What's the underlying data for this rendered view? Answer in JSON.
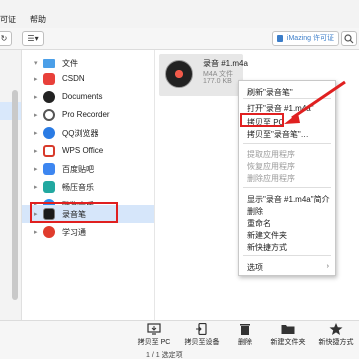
{
  "menubar": {
    "item1": "可证",
    "item2": "帮助"
  },
  "toolbar": {
    "refresh_glyph": "↻",
    "view_glyph": "☰▾",
    "license_button": "iMazing 许可证"
  },
  "tree": {
    "root_label": "文件",
    "apps": [
      {
        "label": "CSDN",
        "color": "#e8403a"
      },
      {
        "label": "Documents",
        "color": "#222222"
      },
      {
        "label": "Pro Recorder",
        "color": "#555555"
      },
      {
        "label": "QQ浏览器",
        "color": "#2a7be4"
      },
      {
        "label": "WPS Office",
        "color": "#d83a2b"
      },
      {
        "label": "百度贴吧",
        "color": "#3d86f0"
      },
      {
        "label": "畅压音乐",
        "color": "#22a8a0"
      },
      {
        "label": "酷狗音乐",
        "color": "#2b8ef2"
      },
      {
        "label": "录音笔",
        "color": "#1a1a1a"
      },
      {
        "label": "学习通",
        "color": "#e03c2d"
      }
    ]
  },
  "file": {
    "name": "录音 #1.m4a",
    "type": "M4A 文件",
    "size": "177.0 KB"
  },
  "context_menu": {
    "items": [
      {
        "label": "刷新\"录音笔\"",
        "disabled": false
      },
      {
        "label": "打开\"录音 #1.m4a\"",
        "disabled": false
      },
      {
        "label": "拷贝至 PC",
        "disabled": false
      },
      {
        "label": "拷贝至\"录音笔\"…",
        "disabled": false
      },
      {
        "label": "提取应用程序",
        "disabled": true
      },
      {
        "label": "恢复应用程序",
        "disabled": true
      },
      {
        "label": "删除应用程序",
        "disabled": true
      },
      {
        "label": "显示\"录音 #1.m4a\"简介",
        "disabled": false
      },
      {
        "label": "删除",
        "disabled": false
      },
      {
        "label": "重命名",
        "disabled": false
      },
      {
        "label": "新建文件夹",
        "disabled": false
      },
      {
        "label": "新快捷方式",
        "disabled": false
      },
      {
        "label": "选项",
        "disabled": false
      }
    ]
  },
  "bottombar": {
    "buttons": [
      {
        "label": "拷贝至 PC",
        "icon": "copy-to-pc-icon"
      },
      {
        "label": "拷贝至设备",
        "icon": "copy-to-device-icon"
      },
      {
        "label": "删除",
        "icon": "trash-icon"
      },
      {
        "label": "新建文件夹",
        "icon": "new-folder-icon"
      },
      {
        "label": "新快捷方式",
        "icon": "star-icon"
      }
    ],
    "status": "1 / 1 选定项"
  },
  "accent": "#e02020"
}
